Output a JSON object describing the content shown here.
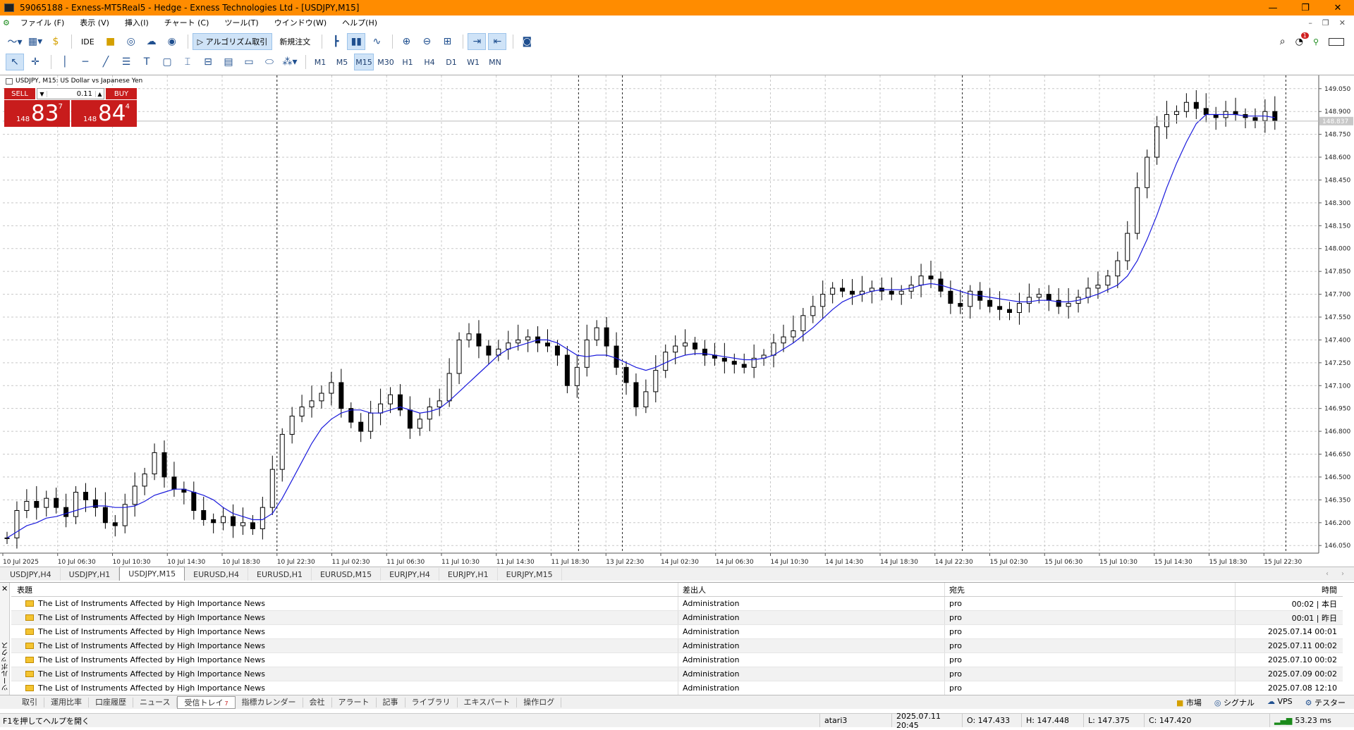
{
  "window": {
    "title": "59065188 - Exness-MT5Real5 - Hedge - Exness Technologies Ltd - [USDJPY,M15]",
    "controls": [
      "—",
      "❐",
      "✕"
    ]
  },
  "menu": {
    "items": [
      "ファイル (F)",
      "表示 (V)",
      "挿入(I)",
      "チャート (C)",
      "ツール(T)",
      "ウインドウ(W)",
      "ヘルプ(H)"
    ],
    "mdi": [
      "–",
      "❐",
      "✕"
    ]
  },
  "toolbar1": {
    "ide": "IDE",
    "algo": "▷ アルゴリズム取引",
    "new_order": "新規注文",
    "notif_count": "1"
  },
  "toolbar2": {
    "timeframes": [
      "M1",
      "M5",
      "M15",
      "M30",
      "H1",
      "H4",
      "D1",
      "W1",
      "MN"
    ],
    "active": "M15"
  },
  "chart": {
    "symbol_label": "USDJPY, M15: US Dollar vs Japanese Yen",
    "trade": {
      "sell": "SELL",
      "buy": "BUY",
      "lot": "0.11",
      "sell_pre": "148",
      "sell_big": "83",
      "sell_sup": "7",
      "buy_pre": "148",
      "buy_big": "84",
      "buy_sup": "4"
    },
    "current_price": "148.837",
    "colors": {
      "up": "#000000",
      "ma": "#1a1adc",
      "grid": "#c8c8c8",
      "ask": "#c8c8c8"
    }
  },
  "chart_data": {
    "type": "line",
    "title": "USDJPY, M15: US Dollar vs Japanese Yen",
    "y_ticks": [
      "149.050",
      "148.900",
      "148.750",
      "148.600",
      "148.450",
      "148.300",
      "148.150",
      "148.000",
      "147.850",
      "147.700",
      "147.550",
      "147.400",
      "147.250",
      "147.100",
      "146.950",
      "146.800",
      "146.650",
      "146.500",
      "146.350",
      "146.200",
      "146.050"
    ],
    "x_ticks": [
      "10 Jul 2025",
      "10 Jul 06:30",
      "10 Jul 10:30",
      "10 Jul 14:30",
      "10 Jul 18:30",
      "10 Jul 22:30",
      "11 Jul 02:30",
      "11 Jul 06:30",
      "11 Jul 10:30",
      "11 Jul 14:30",
      "11 Jul 18:30",
      "13 Jul 22:30",
      "14 Jul 02:30",
      "14 Jul 06:30",
      "14 Jul 10:30",
      "14 Jul 14:30",
      "14 Jul 18:30",
      "14 Jul 22:30",
      "15 Jul 02:30",
      "15 Jul 06:30",
      "15 Jul 10:30",
      "15 Jul 14:30",
      "15 Jul 18:30",
      "15 Jul 22:30"
    ],
    "ylim": [
      146.0,
      149.1
    ],
    "close": [
      146.1,
      146.28,
      146.34,
      146.3,
      146.36,
      146.3,
      146.24,
      146.4,
      146.35,
      146.3,
      146.2,
      146.18,
      146.32,
      146.44,
      146.52,
      146.66,
      146.5,
      146.42,
      146.4,
      146.28,
      146.22,
      146.2,
      146.24,
      146.18,
      146.2,
      146.16,
      146.3,
      146.55,
      146.78,
      146.9,
      146.96,
      147.0,
      147.05,
      147.12,
      146.95,
      146.86,
      146.8,
      146.92,
      146.98,
      147.04,
      146.94,
      146.82,
      146.88,
      146.96,
      147.0,
      147.18,
      147.4,
      147.44,
      147.36,
      147.3,
      147.34,
      147.38,
      147.4,
      147.42,
      147.38,
      147.36,
      147.3,
      147.1,
      147.22,
      147.4,
      147.48,
      147.36,
      147.22,
      147.12,
      146.96,
      147.06,
      147.2,
      147.32,
      147.36,
      147.38,
      147.34,
      147.3,
      147.28,
      147.26,
      147.24,
      147.22,
      147.28,
      147.3,
      147.38,
      147.42,
      147.46,
      147.56,
      147.62,
      147.7,
      147.74,
      147.72,
      147.7,
      147.72,
      147.74,
      147.72,
      147.7,
      147.72,
      147.76,
      147.82,
      147.8,
      147.72,
      147.64,
      147.62,
      147.72,
      147.66,
      147.62,
      147.6,
      147.58,
      147.64,
      147.68,
      147.7,
      147.66,
      147.62,
      147.64,
      147.68,
      147.74,
      147.76,
      147.82,
      147.92,
      148.1,
      148.4,
      148.6,
      148.8,
      148.88,
      148.9,
      148.96,
      148.92,
      148.88,
      148.86,
      148.9,
      148.88,
      148.86,
      148.84,
      148.9,
      148.84
    ],
    "ma": [
      146.1,
      146.14,
      146.18,
      146.2,
      146.23,
      146.24,
      146.26,
      146.28,
      146.3,
      146.31,
      146.31,
      146.3,
      146.3,
      146.31,
      146.34,
      146.38,
      146.4,
      146.42,
      146.42,
      146.4,
      146.38,
      146.35,
      146.3,
      146.26,
      146.24,
      146.22,
      146.22,
      146.26,
      146.36,
      146.48,
      146.6,
      146.72,
      146.82,
      146.88,
      146.92,
      146.94,
      146.94,
      146.92,
      146.92,
      146.94,
      146.96,
      146.94,
      146.92,
      146.93,
      146.95,
      147.0,
      147.06,
      147.12,
      147.18,
      147.24,
      147.3,
      147.34,
      147.36,
      147.38,
      147.4,
      147.4,
      147.38,
      147.34,
      147.3,
      147.29,
      147.3,
      147.3,
      147.28,
      147.25,
      147.22,
      147.2,
      147.22,
      147.25,
      147.28,
      147.3,
      147.31,
      147.31,
      147.3,
      147.29,
      147.28,
      147.27,
      147.27,
      147.28,
      147.3,
      147.34,
      147.38,
      147.43,
      147.48,
      147.54,
      147.6,
      147.65,
      147.68,
      147.7,
      147.72,
      147.73,
      147.73,
      147.73,
      147.74,
      147.76,
      147.77,
      147.76,
      147.74,
      147.72,
      147.7,
      147.69,
      147.68,
      147.67,
      147.66,
      147.65,
      147.65,
      147.66,
      147.66,
      147.65,
      147.65,
      147.66,
      147.68,
      147.7,
      147.73,
      147.76,
      147.82,
      147.92,
      148.06,
      148.22,
      148.4,
      148.56,
      148.7,
      148.82,
      148.88,
      148.88,
      148.88,
      148.88,
      148.87,
      148.87,
      148.87,
      148.86
    ]
  },
  "chart_tabs": {
    "items": [
      "USDJPY,H4",
      "USDJPY,H1",
      "USDJPY,M15",
      "EURUSD,H4",
      "EURUSD,H1",
      "EURUSD,M15",
      "EURJPY,H4",
      "EURJPY,H1",
      "EURJPY,M15"
    ],
    "active": "USDJPY,M15"
  },
  "toolbox": {
    "close": "✕",
    "vertical_title": "ツールボックス",
    "headers": {
      "subject": "表題",
      "from": "差出人",
      "to": "宛先",
      "time": "時間"
    },
    "rows": [
      {
        "subject": "The List of Instruments Affected by High Importance News",
        "from": "Administration",
        "to": "pro",
        "time": "00:02 | 本日"
      },
      {
        "subject": "The List of Instruments Affected by High Importance News",
        "from": "Administration",
        "to": "pro",
        "time": "00:01 | 昨日"
      },
      {
        "subject": "The List of Instruments Affected by High Importance News",
        "from": "Administration",
        "to": "pro",
        "time": "2025.07.14 00:01"
      },
      {
        "subject": "The List of Instruments Affected by High Importance News",
        "from": "Administration",
        "to": "pro",
        "time": "2025.07.11 00:02"
      },
      {
        "subject": "The List of Instruments Affected by High Importance News",
        "from": "Administration",
        "to": "pro",
        "time": "2025.07.10 00:02"
      },
      {
        "subject": "The List of Instruments Affected by High Importance News",
        "from": "Administration",
        "to": "pro",
        "time": "2025.07.09 00:02"
      },
      {
        "subject": "The List of Instruments Affected by High Importance News",
        "from": "Administration",
        "to": "pro",
        "time": "2025.07.08 12:10"
      }
    ]
  },
  "bottom_tabs": {
    "items": [
      "取引",
      "運用比率",
      "口座履歴",
      "ニュース",
      "受信トレイ",
      "指標カレンダー",
      "会社",
      "アラート",
      "記事",
      "ライブラリ",
      "エキスパート",
      "操作ログ"
    ],
    "active": "受信トレイ",
    "badge": "7",
    "right": [
      "市場",
      "シグナル",
      "VPS",
      "テスター"
    ]
  },
  "status": {
    "help": "F1を押してヘルプを開く",
    "profile": "atari3",
    "datetime": "2025.07.11 20:45",
    "open": "O: 147.433",
    "high": "H: 147.448",
    "low": "L: 147.375",
    "close": "C: 147.420",
    "ping": "53.23 ms"
  }
}
